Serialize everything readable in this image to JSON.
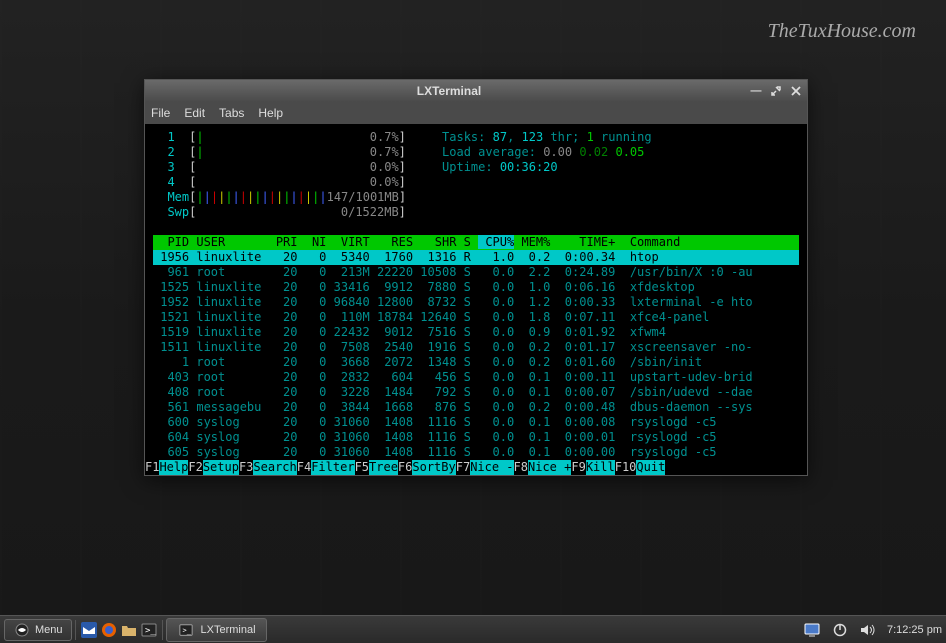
{
  "watermark": "TheTuxHouse.com",
  "window": {
    "title": "LXTerminal",
    "menu": [
      "File",
      "Edit",
      "Tabs",
      "Help"
    ]
  },
  "htop": {
    "cpus": [
      {
        "id": "1",
        "bar": "|",
        "pct": "0.7%"
      },
      {
        "id": "2",
        "bar": "|",
        "pct": "0.7%"
      },
      {
        "id": "3",
        "bar": "",
        "pct": "0.0%"
      },
      {
        "id": "4",
        "bar": "",
        "pct": "0.0%"
      }
    ],
    "mem_label": "Mem",
    "mem_bar": "||||||||||||||||||",
    "mem_val": "147/1001MB",
    "swp_label": "Swp",
    "swp_val": "0/1522MB",
    "tasks_label": "Tasks:",
    "tasks": "87",
    "threads": "123",
    "thr_label": "thr;",
    "running": "1",
    "running_label": "running",
    "load_label": "Load average:",
    "load": [
      "0.00",
      "0.02",
      "0.05"
    ],
    "uptime_label": "Uptime:",
    "uptime": "00:36:20",
    "columns": [
      "PID",
      "USER",
      "PRI",
      "NI",
      "VIRT",
      "RES",
      "SHR",
      "S",
      "CPU%",
      "MEM%",
      "TIME+",
      "Command"
    ],
    "procs": [
      {
        "pid": "1956",
        "user": "linuxlite",
        "pri": "20",
        "ni": "0",
        "virt": "5340",
        "res": "1760",
        "shr": "1316",
        "s": "R",
        "cpu": "1.0",
        "mem": "0.2",
        "time": "0:00.34",
        "cmd": "htop",
        "sel": true
      },
      {
        "pid": "961",
        "user": "root",
        "pri": "20",
        "ni": "0",
        "virt": "213M",
        "res": "22220",
        "shr": "10508",
        "s": "S",
        "cpu": "0.0",
        "mem": "2.2",
        "time": "0:24.89",
        "cmd": "/usr/bin/X :0 -au"
      },
      {
        "pid": "1525",
        "user": "linuxlite",
        "pri": "20",
        "ni": "0",
        "virt": "33416",
        "res": "9912",
        "shr": "7880",
        "s": "S",
        "cpu": "0.0",
        "mem": "1.0",
        "time": "0:06.16",
        "cmd": "xfdesktop"
      },
      {
        "pid": "1952",
        "user": "linuxlite",
        "pri": "20",
        "ni": "0",
        "virt": "96840",
        "res": "12800",
        "shr": "8732",
        "s": "S",
        "cpu": "0.0",
        "mem": "1.2",
        "time": "0:00.33",
        "cmd": "lxterminal -e hto"
      },
      {
        "pid": "1521",
        "user": "linuxlite",
        "pri": "20",
        "ni": "0",
        "virt": "110M",
        "res": "18784",
        "shr": "12640",
        "s": "S",
        "cpu": "0.0",
        "mem": "1.8",
        "time": "0:07.11",
        "cmd": "xfce4-panel"
      },
      {
        "pid": "1519",
        "user": "linuxlite",
        "pri": "20",
        "ni": "0",
        "virt": "22432",
        "res": "9012",
        "shr": "7516",
        "s": "S",
        "cpu": "0.0",
        "mem": "0.9",
        "time": "0:01.92",
        "cmd": "xfwm4"
      },
      {
        "pid": "1511",
        "user": "linuxlite",
        "pri": "20",
        "ni": "0",
        "virt": "7508",
        "res": "2540",
        "shr": "1916",
        "s": "S",
        "cpu": "0.0",
        "mem": "0.2",
        "time": "0:01.17",
        "cmd": "xscreensaver -no-"
      },
      {
        "pid": "1",
        "user": "root",
        "pri": "20",
        "ni": "0",
        "virt": "3668",
        "res": "2072",
        "shr": "1348",
        "s": "S",
        "cpu": "0.0",
        "mem": "0.2",
        "time": "0:01.60",
        "cmd": "/sbin/init"
      },
      {
        "pid": "403",
        "user": "root",
        "pri": "20",
        "ni": "0",
        "virt": "2832",
        "res": "604",
        "shr": "456",
        "s": "S",
        "cpu": "0.0",
        "mem": "0.1",
        "time": "0:00.11",
        "cmd": "upstart-udev-brid"
      },
      {
        "pid": "408",
        "user": "root",
        "pri": "20",
        "ni": "0",
        "virt": "3228",
        "res": "1484",
        "shr": "792",
        "s": "S",
        "cpu": "0.0",
        "mem": "0.1",
        "time": "0:00.07",
        "cmd": "/sbin/udevd --dae"
      },
      {
        "pid": "561",
        "user": "messagebu",
        "pri": "20",
        "ni": "0",
        "virt": "3844",
        "res": "1668",
        "shr": "876",
        "s": "S",
        "cpu": "0.0",
        "mem": "0.2",
        "time": "0:00.48",
        "cmd": "dbus-daemon --sys"
      },
      {
        "pid": "600",
        "user": "syslog",
        "pri": "20",
        "ni": "0",
        "virt": "31060",
        "res": "1408",
        "shr": "1116",
        "s": "S",
        "cpu": "0.0",
        "mem": "0.1",
        "time": "0:00.08",
        "cmd": "rsyslogd -c5"
      },
      {
        "pid": "604",
        "user": "syslog",
        "pri": "20",
        "ni": "0",
        "virt": "31060",
        "res": "1408",
        "shr": "1116",
        "s": "S",
        "cpu": "0.0",
        "mem": "0.1",
        "time": "0:00.01",
        "cmd": "rsyslogd -c5"
      },
      {
        "pid": "605",
        "user": "syslog",
        "pri": "20",
        "ni": "0",
        "virt": "31060",
        "res": "1408",
        "shr": "1116",
        "s": "S",
        "cpu": "0.0",
        "mem": "0.1",
        "time": "0:00.00",
        "cmd": "rsyslogd -c5"
      }
    ],
    "fkeys": [
      {
        "k": "F1",
        "l": "Help  "
      },
      {
        "k": "F2",
        "l": "Setup "
      },
      {
        "k": "F3",
        "l": "Search"
      },
      {
        "k": "F4",
        "l": "Filter"
      },
      {
        "k": "F5",
        "l": "Tree  "
      },
      {
        "k": "F6",
        "l": "SortBy"
      },
      {
        "k": "F7",
        "l": "Nice -"
      },
      {
        "k": "F8",
        "l": "Nice +"
      },
      {
        "k": "F9",
        "l": "Kill  "
      },
      {
        "k": "F10",
        "l": "Quit  "
      }
    ]
  },
  "taskbar": {
    "menu": "Menu",
    "task": "LXTerminal",
    "time": "7:12:25 pm"
  }
}
